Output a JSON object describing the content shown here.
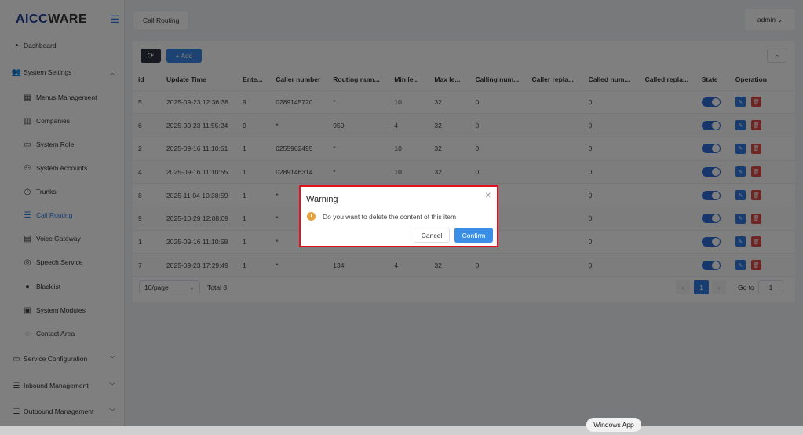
{
  "app": {
    "logo_part1": "AICC",
    "logo_part2": "WARE",
    "collapse_icon": "menu-fold-icon"
  },
  "header": {
    "tab_label": "Call Routing",
    "user_label": "admin"
  },
  "sidebar": {
    "items": [
      {
        "label": "Dashboard",
        "icon": "dashboard-icon"
      },
      {
        "label": "System Settings",
        "icon": "users-icon"
      },
      {
        "label": "Menus Management",
        "icon": "grid-icon"
      },
      {
        "label": "Companies",
        "icon": "building-icon"
      },
      {
        "label": "System Role",
        "icon": "id-card-icon"
      },
      {
        "label": "System Accounts",
        "icon": "user-icon"
      },
      {
        "label": "Trunks",
        "icon": "clock-icon"
      },
      {
        "label": "Call Routing",
        "icon": "list-icon"
      },
      {
        "label": "Voice Gateway",
        "icon": "calendar-icon"
      },
      {
        "label": "Speech Service",
        "icon": "globe-icon"
      },
      {
        "label": "Blacklist",
        "icon": "person-icon"
      },
      {
        "label": "System Modules",
        "icon": "module-icon"
      },
      {
        "label": "Contact Area",
        "icon": "location-icon"
      },
      {
        "label": "Service Configuration",
        "icon": "config-card-icon"
      },
      {
        "label": "Inbound Management",
        "icon": "inbound-list-icon"
      },
      {
        "label": "Outbound Management",
        "icon": "outbound-list-icon"
      }
    ]
  },
  "toolbar": {
    "add_label": "+ Add"
  },
  "table": {
    "headers": [
      "id",
      "Update Time",
      "Ente...",
      "Caller number",
      "Routing num...",
      "Min le...",
      "Max le...",
      "Calling num...",
      "Caller repla...",
      "Called num...",
      "Called repla...",
      "State",
      "Operation"
    ],
    "rows": [
      [
        "5",
        "2025-09-23 12:36:38",
        "9",
        "0289145720",
        "*",
        "10",
        "32",
        "0",
        "",
        "0",
        ""
      ],
      [
        "6",
        "2025-09-23 11:55:24",
        "9",
        "*",
        "950",
        "4",
        "32",
        "0",
        "",
        "0",
        ""
      ],
      [
        "2",
        "2025-09-16 11:10:51",
        "1",
        "0255962495",
        "*",
        "10",
        "32",
        "0",
        "",
        "0",
        ""
      ],
      [
        "4",
        "2025-09-16 11:10:55",
        "1",
        "0289146314",
        "*",
        "10",
        "32",
        "0",
        "",
        "0",
        ""
      ],
      [
        "8",
        "2025-11-04 10:38:59",
        "1",
        "*",
        "",
        "",
        "",
        "",
        "",
        "0",
        ""
      ],
      [
        "9",
        "2025-10-29 12:08:09",
        "1",
        "*",
        "",
        "",
        "",
        "",
        "",
        "0",
        ""
      ],
      [
        "1",
        "2025-09-16 11:10:58",
        "1",
        "*",
        "",
        "",
        "",
        "",
        "",
        "0",
        ""
      ],
      [
        "7",
        "2025-09-23 17:29:49",
        "1",
        "*",
        "134",
        "4",
        "32",
        "0",
        "",
        "0",
        ""
      ]
    ]
  },
  "pagination": {
    "page_size": "10/page",
    "total": "Total 8",
    "current_page": "1",
    "goto_label": "Go to",
    "goto_value": "1"
  },
  "dialog": {
    "title": "Warning",
    "message": "Do you want to delete the content of this item",
    "cancel_label": "Cancel",
    "confirm_label": "Confirm"
  },
  "taskbar": {
    "tooltip": "Windows App"
  },
  "colors": {
    "accent": "#2f7be5",
    "danger": "#e04b4b",
    "warning": "#e6a23c",
    "highlight_border": "#e0141e"
  }
}
